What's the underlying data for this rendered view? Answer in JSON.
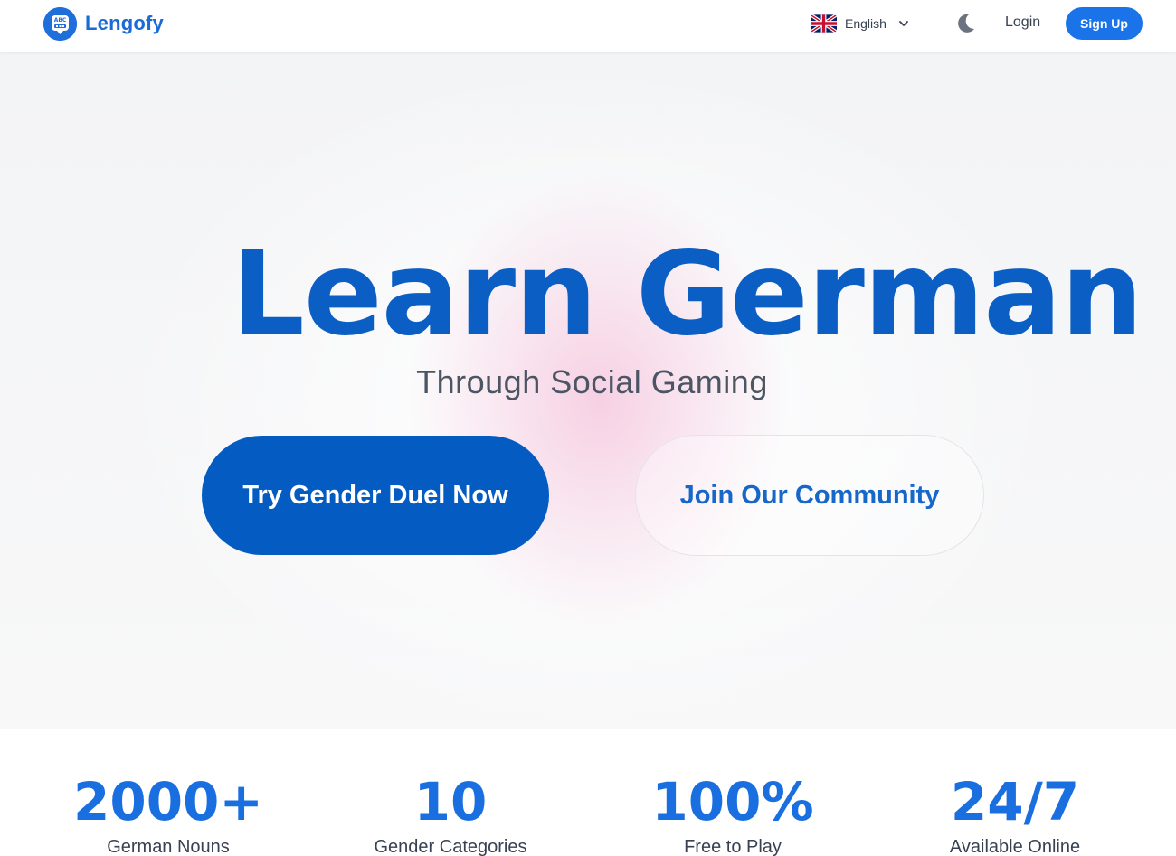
{
  "brand": {
    "name": "Lengofy",
    "badge_text": "ABC"
  },
  "header": {
    "language": {
      "label": "English",
      "flag": "uk-flag-icon"
    },
    "theme_toggle_icon": "moon-icon",
    "login_label": "Login",
    "signup_label": "Sign Up"
  },
  "hero": {
    "title": "Learn German",
    "subtitle": "Through Social Gaming",
    "primary_cta": "Try Gender Duel Now",
    "secondary_cta": "Join Our Community"
  },
  "stats": [
    {
      "value": "2000+",
      "label": "German Nouns"
    },
    {
      "value": "10",
      "label": "Gender Categories"
    },
    {
      "value": "100%",
      "label": "Free to Play"
    },
    {
      "value": "24/7",
      "label": "Available Online"
    }
  ],
  "colors": {
    "brand_blue": "#1c6ad6",
    "primary_button": "#045bc1",
    "signup_button": "#1a73e8",
    "stat_blue": "#1a6fe0"
  }
}
